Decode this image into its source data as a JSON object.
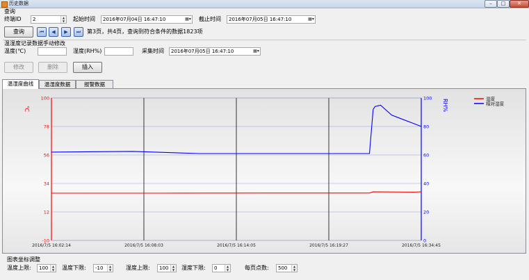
{
  "window": {
    "title": "历史数据",
    "buttons": {
      "minimize": "–",
      "maximize": "□",
      "close": "✕"
    }
  },
  "query": {
    "group_label": "查询",
    "terminal_label": "终端ID",
    "terminal_value": "2",
    "start_label": "起始时间",
    "start_value": "2016年07月04日 16:47:10",
    "end_label": "截止时间",
    "end_value": "2016年07月05日 16:47:10",
    "query_button": "查询",
    "nav": {
      "first": "⏮",
      "prev": "◀",
      "next": "▶",
      "last": "⏭"
    },
    "page_info": "第3页，共4页，查询到符合条件的数据1823项"
  },
  "edit": {
    "group_label": "温湿度记录数据手动修改",
    "temp_label": "温度(℃)",
    "temp_value": "",
    "humidity_label": "湿度(RH%)",
    "humidity_value": "",
    "time_label": "采集时间",
    "time_value": "2016年07月05日 16:47:10",
    "modify_button": "修改",
    "delete_button": "删除",
    "insert_button": "插入"
  },
  "tabs": [
    {
      "label": "温湿度曲线",
      "active": true
    },
    {
      "label": "温湿度数据",
      "active": false
    },
    {
      "label": "报警数据",
      "active": false
    }
  ],
  "chart_data": {
    "type": "line",
    "left_axis_label": "℃",
    "right_axis_label": "RH%",
    "left_ylim": [
      -10,
      100
    ],
    "left_ticks": [
      "100",
      "78",
      "56",
      "34",
      "12",
      "-10"
    ],
    "right_ylim": [
      0,
      100
    ],
    "right_ticks": [
      "100",
      "80",
      "60",
      "40",
      "20",
      "0"
    ],
    "x_ticks": [
      "2016/7/5 16:02:14",
      "2016/7/5 16:08:03",
      "2016/7/5 16:14:05",
      "2016/7/5 16:19:27",
      "2016/7/5 16:34:45"
    ],
    "legend": [
      {
        "name": "温度",
        "color": "#ff0000"
      },
      {
        "name": "相对湿度",
        "color": "#0000ff"
      }
    ],
    "grid": true,
    "legend_position": "top-right",
    "series": [
      {
        "name": "温度",
        "axis": "left",
        "color": "#ff0000",
        "x": [
          0,
          0.3,
          0.6,
          0.86,
          0.87,
          0.98,
          1.0
        ],
        "values": [
          26.5,
          26.5,
          26.6,
          26.6,
          27.5,
          27.3,
          27.5
        ]
      },
      {
        "name": "相对湿度",
        "axis": "right",
        "color": "#0000ff",
        "x": [
          0,
          0.22,
          0.4,
          0.6,
          0.86,
          0.87,
          0.875,
          0.89,
          0.92,
          0.95,
          0.98,
          1.0
        ],
        "values": [
          62,
          62.5,
          61,
          61,
          61,
          92,
          94,
          95,
          88,
          85,
          82,
          80
        ]
      }
    ]
  },
  "axis_settings": {
    "group_label": "图表坐标调整",
    "temp_upper_label": "温度上限:",
    "temp_upper_value": "100",
    "temp_lower_label": "温度下限:",
    "temp_lower_value": "-10",
    "hum_upper_label": "湿度上限:",
    "hum_upper_value": "100",
    "hum_lower_label": "湿度下限:",
    "hum_lower_value": "0",
    "points_label": "每页点数:",
    "points_value": "500"
  },
  "colors": {
    "temperature": "#ff0000",
    "humidity": "#0000ff",
    "nav_accent": "#3a63a8"
  }
}
